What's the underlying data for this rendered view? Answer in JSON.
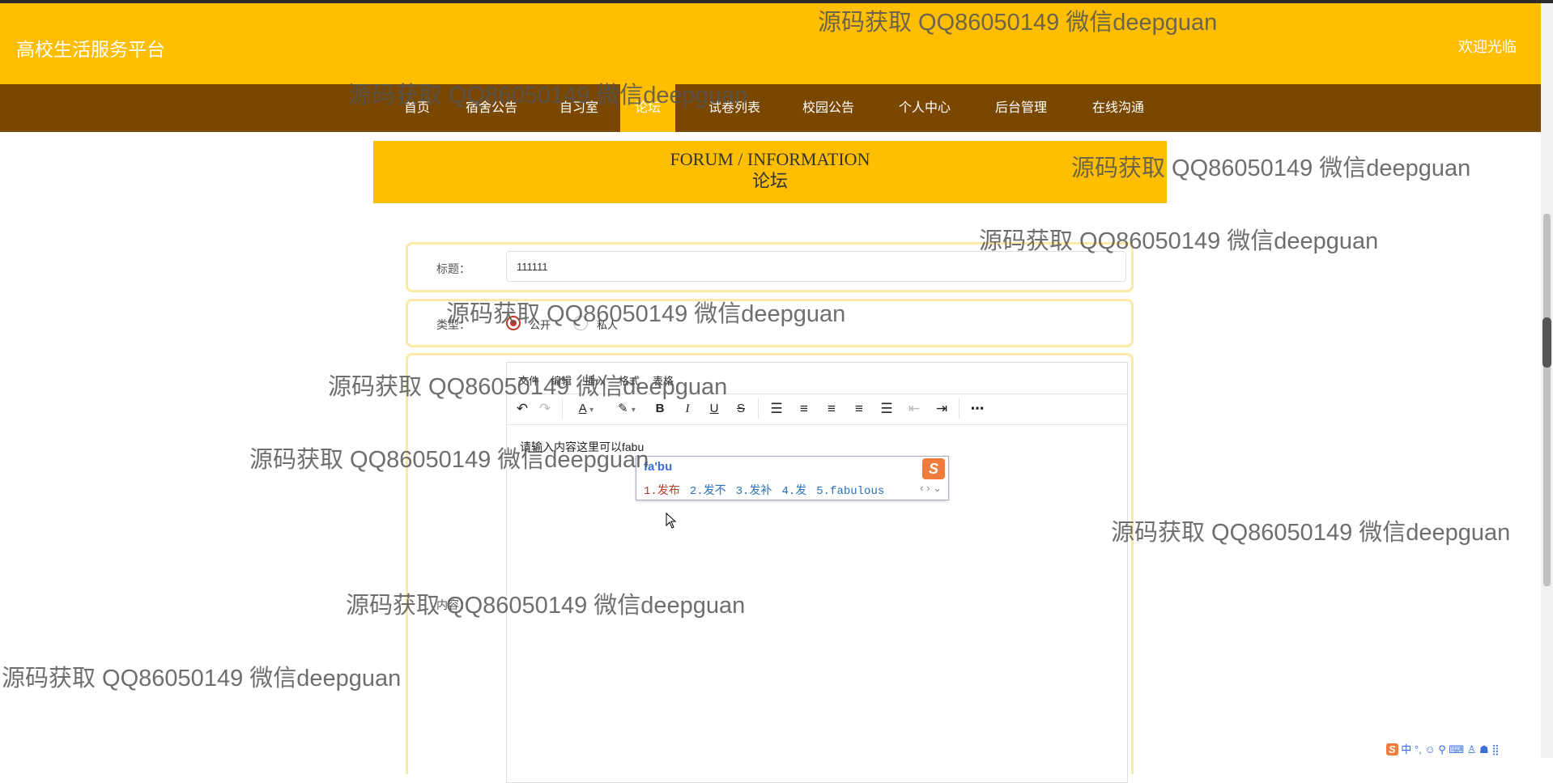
{
  "header": {
    "site_title": "高校生活服务平台",
    "welcome": "欢迎光临"
  },
  "nav": {
    "items": [
      {
        "label": "首页"
      },
      {
        "label": "宿舍公告"
      },
      {
        "label": "自习室"
      },
      {
        "label": "论坛",
        "active": true
      },
      {
        "label": "试卷列表"
      },
      {
        "label": "校园公告"
      },
      {
        "label": "个人中心"
      },
      {
        "label": "后台管理"
      },
      {
        "label": "在线沟通"
      }
    ]
  },
  "banner": {
    "en": "FORUM / INFORMATION",
    "cn": "论坛"
  },
  "form": {
    "title_label": "标题：",
    "title_value": "111111",
    "type_label": "类型：",
    "type_options": [
      {
        "label": "公开",
        "checked": true
      },
      {
        "label": "私人",
        "checked": false
      }
    ],
    "content_label": "内容："
  },
  "editor": {
    "menu": [
      "文件",
      "编辑",
      "插入",
      "格式",
      "表格"
    ],
    "content": "请输入内容这里可以fabu",
    "tools": [
      "undo-icon",
      "redo-icon",
      "font-color-icon",
      "highlight-icon",
      "bold-icon",
      "italic-icon",
      "underline-icon",
      "strikethrough-icon",
      "line-height-icon",
      "align-left-icon",
      "align-center-icon",
      "align-right-icon",
      "align-justify-icon",
      "outdent-icon",
      "indent-icon",
      "more-icon"
    ]
  },
  "ime": {
    "pinyin": "fa'bu",
    "candidates": [
      "1.发布",
      "2.发不",
      "3.发补",
      "4.发",
      "5.fabulous"
    ],
    "logo": "S"
  },
  "taskbar_ime": {
    "text": "中 °, ☺ ⚲ ⌨ ♙ ☗ ⣿"
  },
  "watermark": "源码获取 QQ86050149 微信deepguan",
  "colors": {
    "header": "#ffbe00",
    "nav": "#7a4700",
    "card_border": "#ffe9a6",
    "radio": "#c0392b"
  }
}
